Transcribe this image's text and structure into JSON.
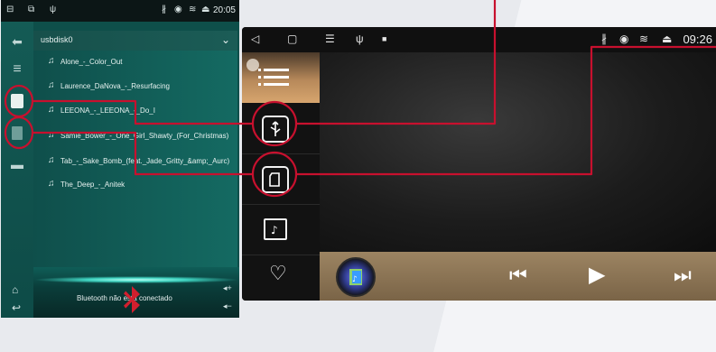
{
  "left_panel": {
    "status_time": "20:05",
    "drive_label": "usbdisk0",
    "files": [
      "Alone_-_Color_Out",
      "Laurence_DaNova_-_Resurfacing",
      "LEEONA_-_LEEONA_-_Do_I",
      "Samie_Bower_-_One_Girl_Shawty_(For_Christmas)",
      "Tab_-_Sake_Bomb_(feat._Jade_Gritty_&amp;_Aurc)",
      "The_Deep_-_Anitek"
    ],
    "bluetooth_status": "Bluetooth não está conectado",
    "volume_up": "◂+",
    "volume_down": "◂−"
  },
  "right_panel": {
    "status_time": "09:26"
  },
  "icons": {
    "left_rail": [
      "back-arrow-icon",
      "menu-icon",
      "usb-drive-icon",
      "sd-card-icon",
      "folder-icon"
    ],
    "right_sidebar": [
      "menu-icon",
      "usb-icon",
      "sd-card-icon",
      "music-folder-icon",
      "heart-icon"
    ],
    "controls": [
      "album-art-icon",
      "previous-icon",
      "play-icon",
      "next-icon"
    ]
  },
  "colors": {
    "annotation_red": "#c8102e",
    "left_bg": "#0e4f4a",
    "right_bg": "#0b0b0b",
    "control_bar": "#8b7455"
  }
}
